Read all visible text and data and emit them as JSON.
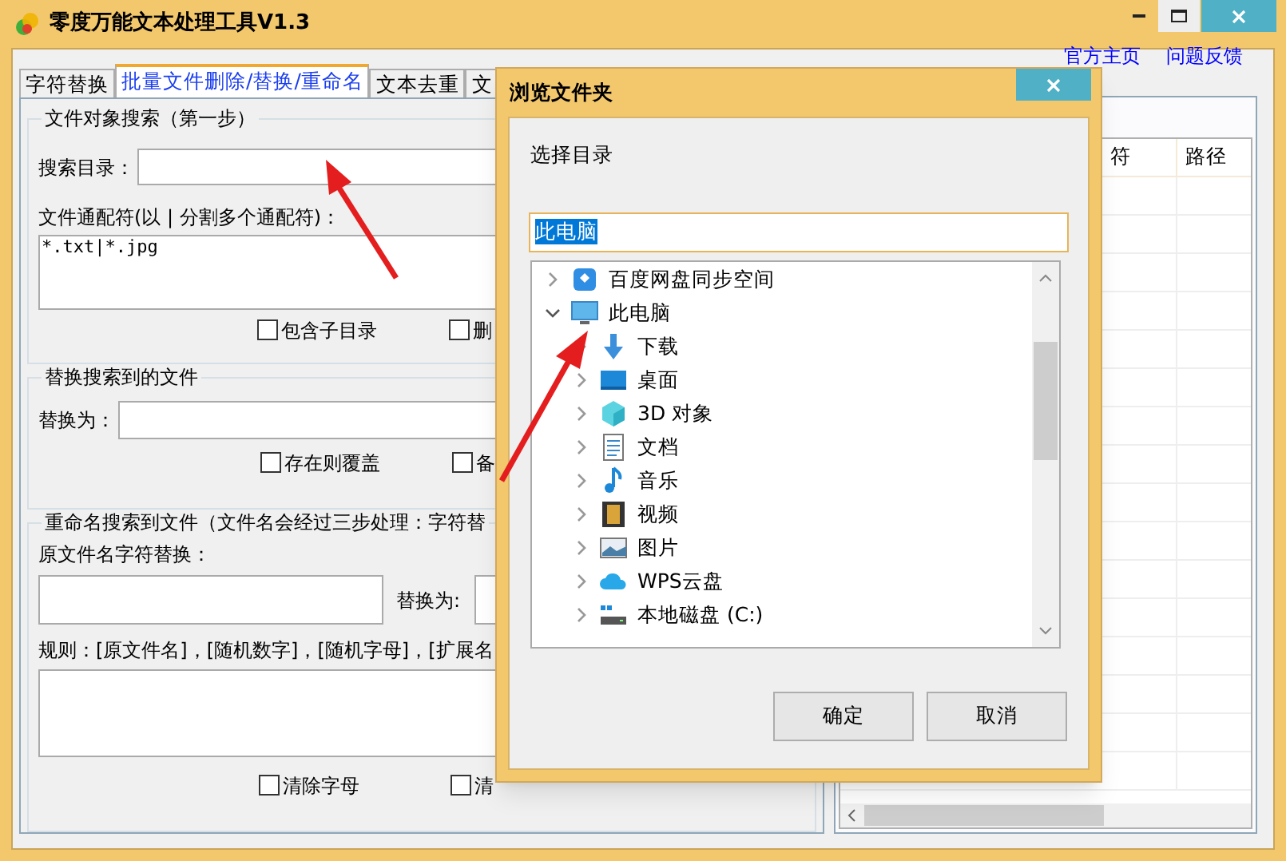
{
  "window": {
    "title": "零度万能文本处理工具V1.3"
  },
  "tabs": [
    {
      "label": "字符替换",
      "selected": false
    },
    {
      "label": "批量文件删除/替换/重命名",
      "selected": true
    },
    {
      "label": "文本去重",
      "selected": false
    },
    {
      "label": "文",
      "selected": false
    }
  ],
  "links": [
    "官方主页",
    "问题反馈"
  ],
  "search_group": {
    "title": "文件对象搜索（第一步）",
    "dir_label": "搜索目录：",
    "wildcard_label": "文件通配符(以 | 分割多个通配符)：",
    "wildcard_value": "*.txt|*.jpg",
    "options": [
      {
        "label": "包含子目录",
        "checked": false
      },
      {
        "label": "删",
        "checked": false
      }
    ]
  },
  "replace_group": {
    "title": "替换搜索到的文件",
    "replace_label": "替换为：",
    "options": [
      {
        "label": "存在则覆盖",
        "checked": false
      },
      {
        "label": "备",
        "checked": false
      }
    ]
  },
  "rename_group": {
    "title": "重命名搜索到文件（文件名会经过三步处理：字符替",
    "original_label": "原文件名字符替换：",
    "replace_label": "替换为:",
    "rule_label": "规则：[原文件名]，[随机数字]，[随机字母]，[扩展名",
    "options": [
      {
        "label": "清除字母",
        "checked": false
      },
      {
        "label": "清",
        "checked": false
      }
    ]
  },
  "table": {
    "columns": [
      "符",
      "路径"
    ]
  },
  "dialog": {
    "title": "浏览文件夹",
    "prompt": "选择目录",
    "field_value": "此电脑",
    "tree": [
      {
        "label": "百度网盘同步空间",
        "kind": "cloud-drive",
        "expanded": false
      },
      {
        "label": "此电脑",
        "kind": "computer",
        "expanded": true,
        "children": [
          {
            "label": "下载",
            "kind": "download",
            "expanded": false
          },
          {
            "label": "桌面",
            "kind": "desktop",
            "expanded": false
          },
          {
            "label": "3D 对象",
            "kind": "cube",
            "expanded": false
          },
          {
            "label": "文档",
            "kind": "document",
            "expanded": false
          },
          {
            "label": "音乐",
            "kind": "music",
            "expanded": false
          },
          {
            "label": "视频",
            "kind": "video",
            "expanded": false
          },
          {
            "label": "图片",
            "kind": "picture",
            "expanded": false
          },
          {
            "label": "WPS云盘",
            "kind": "cloud",
            "expanded": false
          },
          {
            "label": "本地磁盘 (C:)",
            "kind": "disk",
            "expanded": false
          }
        ]
      }
    ],
    "buttons": [
      "确定",
      "取消"
    ]
  }
}
